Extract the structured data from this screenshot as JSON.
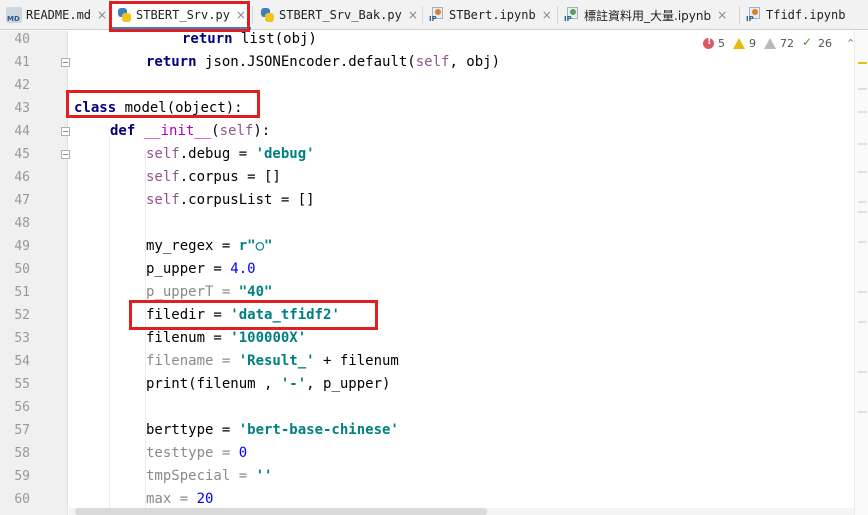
{
  "tabs": [
    {
      "label": "README.md",
      "icon": "markdown-file-icon",
      "icon_text": "MD",
      "active": false
    },
    {
      "label": "STBERT_Srv.py",
      "icon": "python-file-icon",
      "active": true
    },
    {
      "label": "STBERT_Srv_Bak.py",
      "icon": "python-file-icon",
      "active": false
    },
    {
      "label": "STBert.ipynb",
      "icon": "notebook-file-icon",
      "icon_text": "IP",
      "active": false
    },
    {
      "label": "標註資料用_大量.ipynb",
      "icon": "notebook-file-icon",
      "icon_text": "IP",
      "active": false
    },
    {
      "label": "Tfidf.ipynb",
      "icon": "notebook-file-icon",
      "icon_text": "IP",
      "active": false
    }
  ],
  "close_glyph": "×",
  "inspections": {
    "errors": "5",
    "warnings": "9",
    "weak_warnings": "72",
    "typos": "26",
    "expand_glyph": "⌃"
  },
  "line_numbers": [
    "40",
    "41",
    "42",
    "43",
    "44",
    "45",
    "46",
    "47",
    "48",
    "49",
    "50",
    "51",
    "52",
    "53",
    "54",
    "55",
    "56",
    "57",
    "58",
    "59",
    "60"
  ],
  "code_lines": [
    [
      {
        "t": "return",
        "c": "kw"
      },
      {
        "t": " list(obj)",
        "c": "plain"
      }
    ],
    [
      {
        "t": "return",
        "c": "kw"
      },
      {
        "t": " json.JSONEncoder.default(",
        "c": "plain"
      },
      {
        "t": "self",
        "c": "self"
      },
      {
        "t": ", obj)",
        "c": "plain"
      }
    ],
    [],
    [
      {
        "t": "class",
        "c": "kw"
      },
      {
        "t": " model(",
        "c": "plain"
      },
      {
        "t": "object",
        "c": "plain"
      },
      {
        "t": "):",
        "c": "plain"
      }
    ],
    [
      {
        "t": "def",
        "c": "kw"
      },
      {
        "t": " ",
        "c": "plain"
      },
      {
        "t": "__init__",
        "c": "magic"
      },
      {
        "t": "(",
        "c": "plain"
      },
      {
        "t": "self",
        "c": "self"
      },
      {
        "t": "):",
        "c": "plain"
      }
    ],
    [
      {
        "t": "self",
        "c": "self"
      },
      {
        "t": ".debug = ",
        "c": "plain"
      },
      {
        "t": "'debug'",
        "c": "str"
      }
    ],
    [
      {
        "t": "self",
        "c": "self"
      },
      {
        "t": ".corpus = []",
        "c": "plain"
      }
    ],
    [
      {
        "t": "self",
        "c": "self"
      },
      {
        "t": ".corpusList = []",
        "c": "plain"
      }
    ],
    [],
    [
      {
        "t": "my_regex = ",
        "c": "plain"
      },
      {
        "t": "r\"○\"",
        "c": "str"
      }
    ],
    [
      {
        "t": "p_upper = ",
        "c": "plain"
      },
      {
        "t": "4.0",
        "c": "num"
      }
    ],
    [
      {
        "t": "p_upperT = ",
        "c": "dim"
      },
      {
        "t": "\"40\"",
        "c": "str"
      }
    ],
    [
      {
        "t": "filedir = ",
        "c": "plain"
      },
      {
        "t": "'data_tfidf2'",
        "c": "str"
      }
    ],
    [
      {
        "t": "filenum = ",
        "c": "plain"
      },
      {
        "t": "'100000X'",
        "c": "str"
      }
    ],
    [
      {
        "t": "filename = ",
        "c": "dim"
      },
      {
        "t": "'Result_'",
        "c": "str"
      },
      {
        "t": " + filenum",
        "c": "plain"
      }
    ],
    [
      {
        "t": "print(filenum , ",
        "c": "plain"
      },
      {
        "t": "'-'",
        "c": "str"
      },
      {
        "t": ", p_upper)",
        "c": "plain"
      }
    ],
    [],
    [
      {
        "t": "berttype = ",
        "c": "plain"
      },
      {
        "t": "'bert-base-chinese'",
        "c": "str"
      }
    ],
    [
      {
        "t": "testtype = ",
        "c": "dim"
      },
      {
        "t": "0",
        "c": "num"
      }
    ],
    [
      {
        "t": "tmpSpecial = ",
        "c": "dim"
      },
      {
        "t": "''",
        "c": "str"
      }
    ],
    [
      {
        "t": "max = ",
        "c": "dim"
      },
      {
        "t": "20",
        "c": "num"
      }
    ]
  ]
}
